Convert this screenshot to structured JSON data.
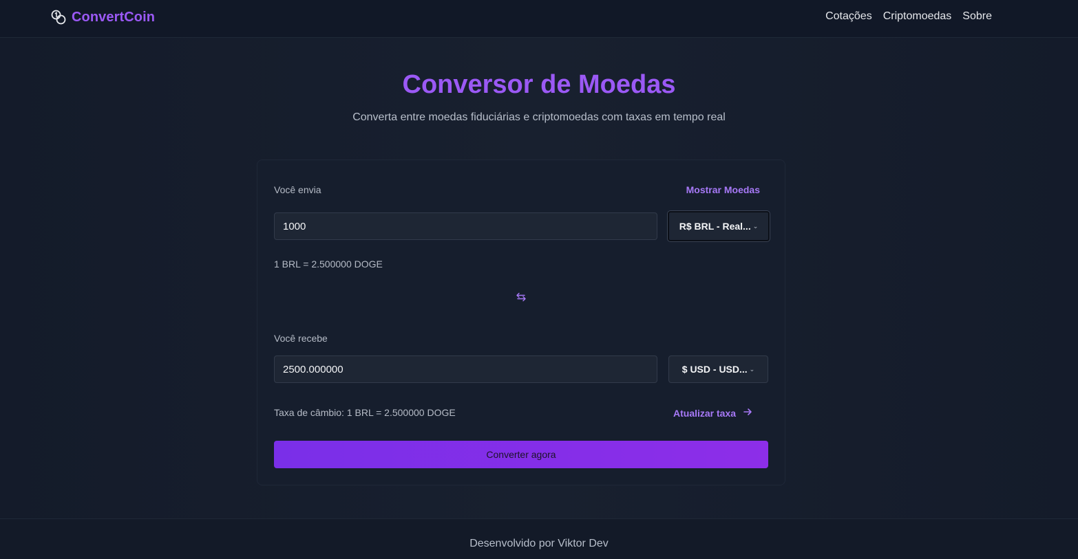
{
  "header": {
    "brand": "ConvertCoin",
    "brand_icon": "coins-icon",
    "nav": [
      "Cotações",
      "Criptomoedas",
      "Sobre"
    ]
  },
  "hero": {
    "title": "Conversor de Moedas",
    "subtitle": "Converta entre moedas fiduciárias e criptomoedas com taxas em tempo real"
  },
  "converter": {
    "send_label": "Você envia",
    "show_currencies": "Mostrar Moedas",
    "send_amount": "1000",
    "send_currency": "R$ BRL - Real...",
    "send_rate": "1 BRL = 2.500000 DOGE",
    "swap_icon": "swap-arrows-icon",
    "receive_label": "Você recebe",
    "receive_amount": "2500.000000",
    "receive_currency": "$ USD - USD...",
    "exchange_rate": "Taxa de câmbio: 1 BRL = 2.500000 DOGE",
    "refresh_rate": "Atualizar taxa",
    "refresh_icon": "arrow-right-icon",
    "convert_button": "Converter agora"
  },
  "footer": {
    "text": "Desenvolvido por Viktor Dev"
  },
  "colors": {
    "accent": "#9b59f5",
    "background": "#131a28",
    "card": "#161e2d",
    "button": "#7a2fe8"
  }
}
